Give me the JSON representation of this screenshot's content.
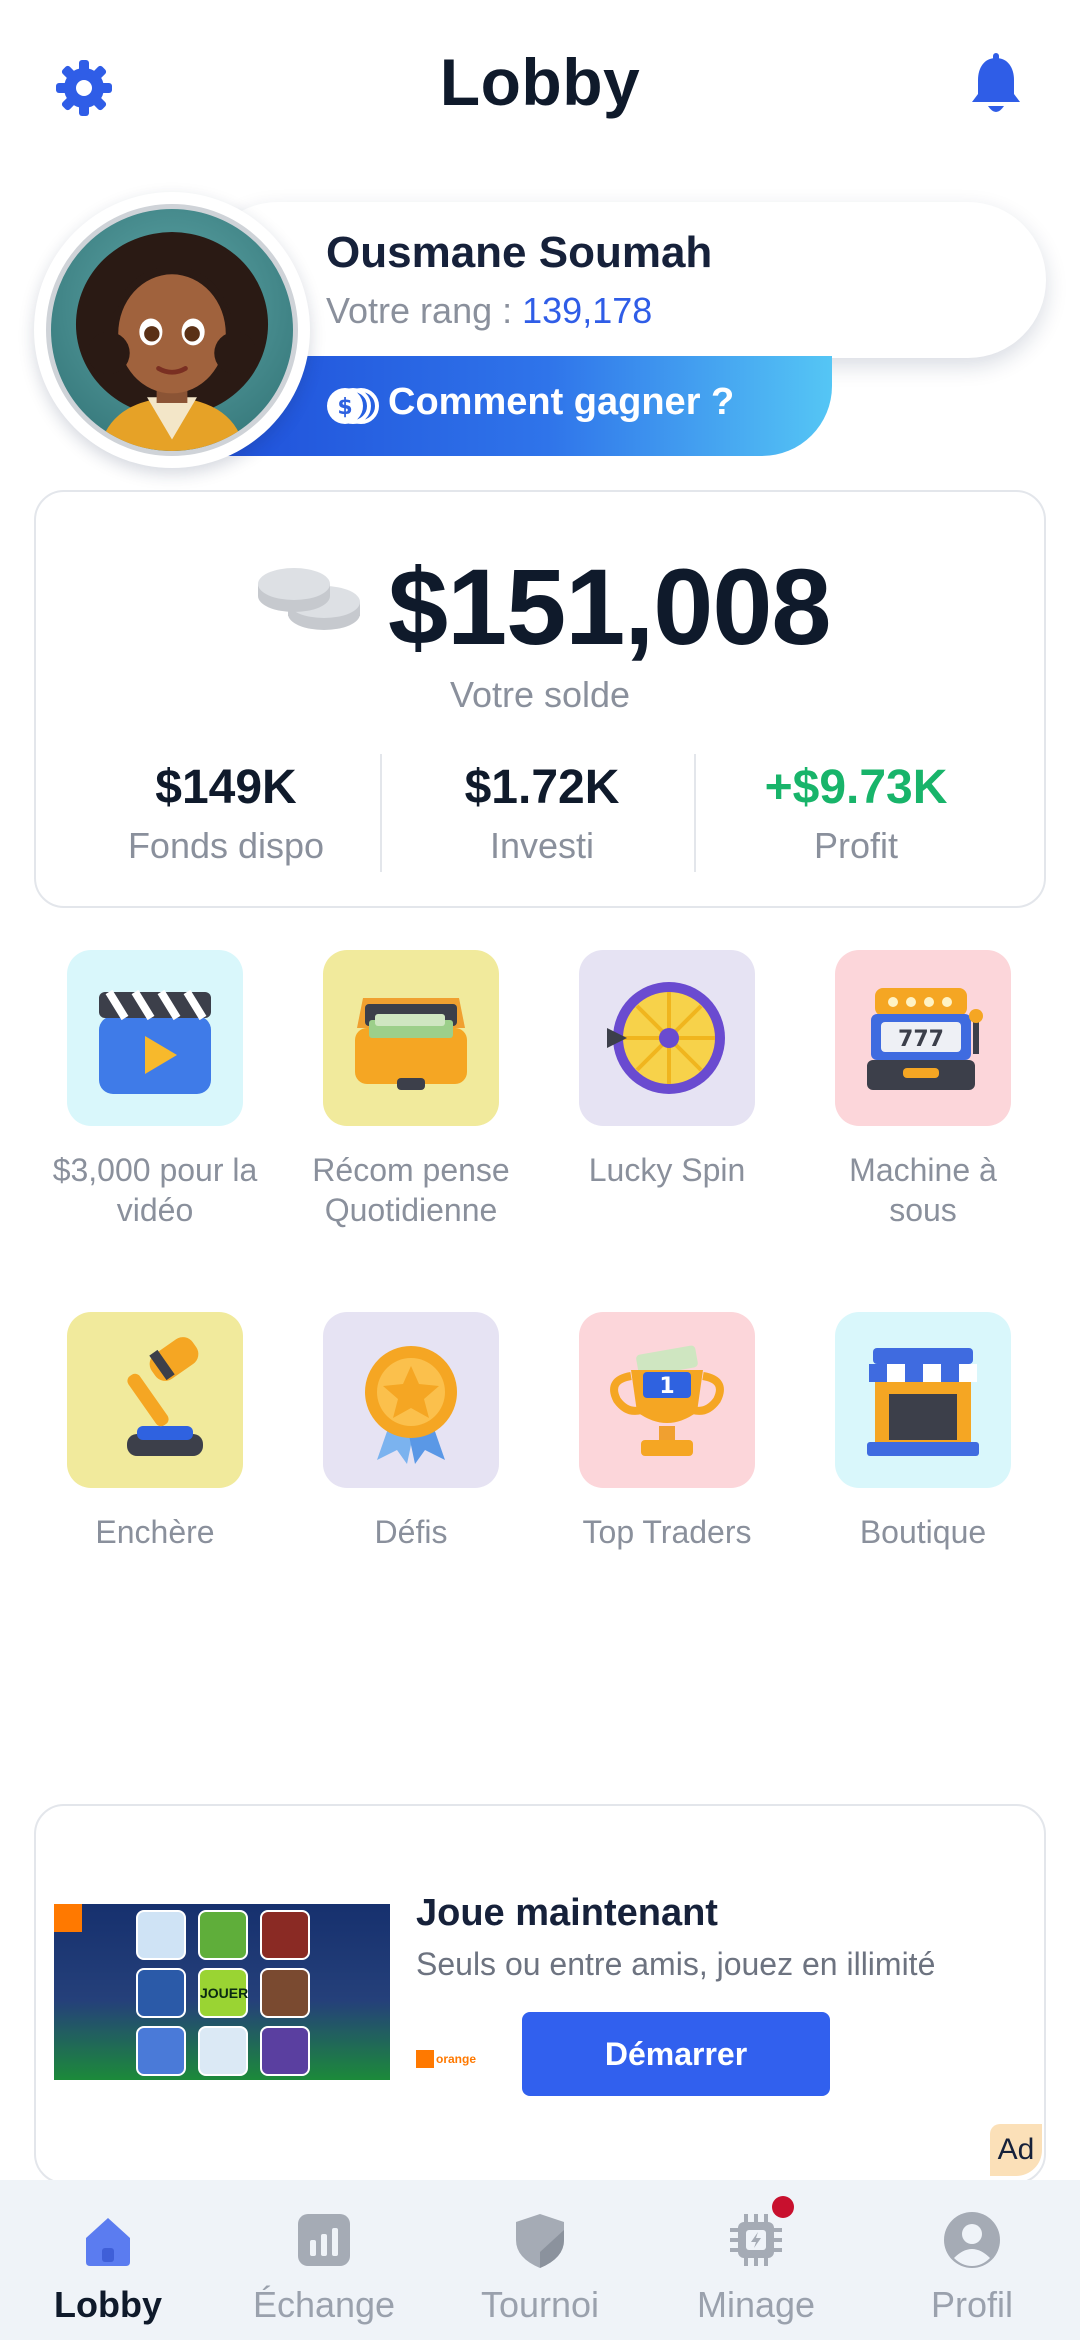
{
  "header": {
    "title": "Lobby",
    "settings_icon": "gear-icon",
    "notifications_icon": "bell-icon",
    "accent": "#2f5de7"
  },
  "profile": {
    "name": "Ousmane Soumah",
    "rank_label": "Votre rang : ",
    "rank_value": "139,178",
    "earn_button": "Comment gagner ?"
  },
  "balance": {
    "amount": "$151,008",
    "label": "Votre solde",
    "stats": [
      {
        "value": "$149K",
        "label": "Fonds dispo"
      },
      {
        "value": "$1.72K",
        "label": "Investi"
      },
      {
        "value": "+$9.73K",
        "label": "Profit",
        "color": "#18b46a"
      }
    ]
  },
  "features": [
    {
      "label": "$3,000 pour la vidéo",
      "icon": "video-clapper-icon",
      "bg": "#d9f7fb"
    },
    {
      "label": "Récom pense Quotidienne",
      "icon": "money-case-icon",
      "bg": "#f1ea9c"
    },
    {
      "label": "Lucky Spin",
      "icon": "spin-wheel-icon",
      "bg": "#e6e3f3"
    },
    {
      "label": "Machine à sous",
      "icon": "slot-machine-icon",
      "bg": "#fcd6da"
    },
    {
      "label": "Enchère",
      "icon": "gavel-icon",
      "bg": "#f1ea9c"
    },
    {
      "label": "Défis",
      "icon": "medal-icon",
      "bg": "#e6e3f3"
    },
    {
      "label": "Top Traders",
      "icon": "trophy-icon",
      "bg": "#fcd6da"
    },
    {
      "label": "Boutique",
      "icon": "shop-icon",
      "bg": "#d9f7fb"
    }
  ],
  "ad": {
    "title": "Joue maintenant",
    "description": "Seuls ou entre amis, jouez en illimité",
    "cta": "Démarrer",
    "badge": "Ad",
    "image_text": "JOUER",
    "brand": "orange"
  },
  "nav": [
    {
      "label": "Lobby",
      "icon": "home-icon",
      "active": true
    },
    {
      "label": "Échange",
      "icon": "chart-icon",
      "active": false
    },
    {
      "label": "Tournoi",
      "icon": "shield-icon",
      "active": false
    },
    {
      "label": "Minage",
      "icon": "chip-icon",
      "active": false,
      "notification_dot": true
    },
    {
      "label": "Profil",
      "icon": "user-icon",
      "active": false
    }
  ]
}
